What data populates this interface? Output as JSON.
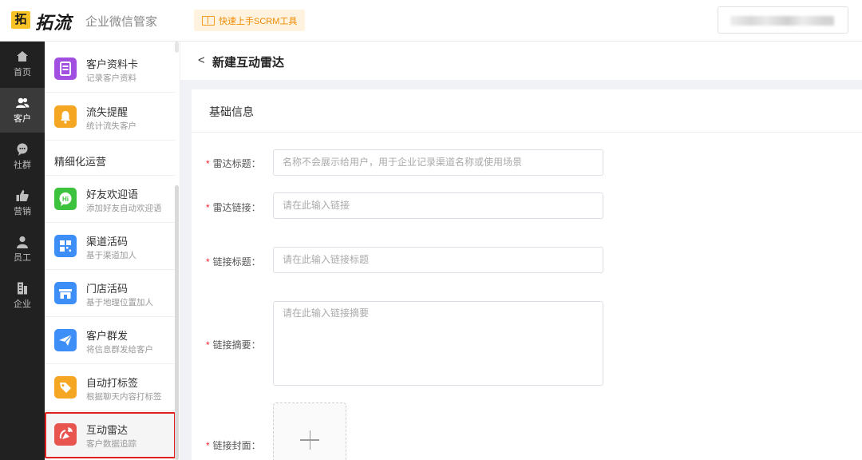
{
  "header": {
    "logo_mark": "拓",
    "logo_text": "拓流",
    "app_title": "企业微信管家",
    "quick_start": "快速上手SCRM工具"
  },
  "nav": {
    "items": [
      {
        "label": "首页",
        "icon": "home-icon"
      },
      {
        "label": "客户",
        "icon": "users-icon",
        "active": true
      },
      {
        "label": "社群",
        "icon": "chat-icon"
      },
      {
        "label": "营销",
        "icon": "thumbs-up-icon"
      },
      {
        "label": "员工",
        "icon": "person-icon"
      },
      {
        "label": "企业",
        "icon": "building-icon"
      }
    ]
  },
  "submenu": {
    "items": [
      {
        "name": "客户资料卡",
        "desc": "记录客户资料",
        "color": "#a14fe0"
      },
      {
        "name": "流失提醒",
        "desc": "统计流失客户",
        "color": "#f5a623"
      },
      {
        "name": "好友欢迎语",
        "desc": "添加好友自动欢迎语",
        "color": "#3cc23c"
      },
      {
        "name": "渠道活码",
        "desc": "基于渠道加人",
        "color": "#3d8ef7"
      },
      {
        "name": "门店活码",
        "desc": "基于地理位置加人",
        "color": "#3d8ef7"
      },
      {
        "name": "客户群发",
        "desc": "将信息群发给客户",
        "color": "#3d8ef7"
      },
      {
        "name": "自动打标签",
        "desc": "根据聊天内容打标签",
        "color": "#f5a623"
      },
      {
        "name": "互动雷达",
        "desc": "客户数据追踪",
        "color": "#e8554e"
      }
    ],
    "group_label": "精细化运营"
  },
  "page": {
    "back": "<",
    "title": "新建互动雷达"
  },
  "form": {
    "section_title": "基础信息",
    "fields": {
      "radar_title": {
        "label": "雷达标题：",
        "placeholder": "名称不会展示给用户，用于企业记录渠道名称或使用场景"
      },
      "radar_link": {
        "label": "雷达链接：",
        "placeholder": "请在此输入链接"
      },
      "link_title": {
        "label": "链接标题：",
        "placeholder": "请在此输入链接标题"
      },
      "link_summary": {
        "label": "链接摘要：",
        "placeholder": "请在此输入链接摘要"
      },
      "link_cover": {
        "label": "链接封面："
      }
    },
    "required_mark": "*"
  }
}
